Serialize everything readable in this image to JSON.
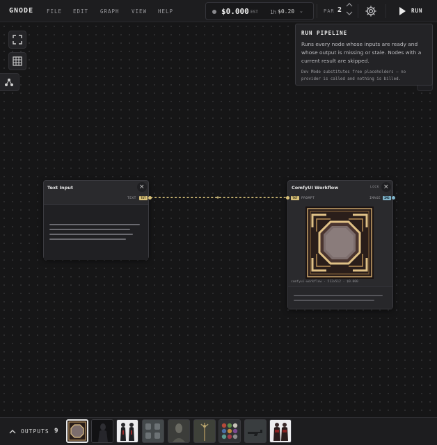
{
  "app": {
    "logo": "GNODE"
  },
  "menu": [
    "FILE",
    "EDIT",
    "GRAPH",
    "VIEW",
    "HELP"
  ],
  "cost": {
    "value": "$0.000",
    "est_label": "EST",
    "rate_label": "1h",
    "rate_value": "$0.20"
  },
  "parallel": {
    "label": "PAR",
    "value": "2"
  },
  "run": {
    "label": "RUN"
  },
  "tooltip": {
    "title": "RUN PIPELINE",
    "body": "Runs every node whose inputs are ready and whose output is missing or stale. Nodes with a current result are skipped.",
    "note": "Dev Mode substitutes free placeholders — no provider is called and nothing is billed."
  },
  "nodes": {
    "text_input": {
      "title": "Text Input",
      "close": "×",
      "out_port_label": "TEXT",
      "out_port_tag": "TXT"
    },
    "comfy": {
      "title": "ComfyUI Workflow",
      "lock": "LOCK",
      "close": "×",
      "in_port_tag": "TXT",
      "in_port_label": "PROMPT",
      "out_port_label": "IMAGE",
      "out_port_tag": "IMG",
      "footer": "comfyui-workflow · 512x512 · $0.000"
    }
  },
  "outputs": {
    "label": "OUTPUTS",
    "count": "9"
  },
  "colors": {
    "txt_tag_bg": "#d9c27a",
    "img_tag_bg": "#7fb3c9",
    "edge": "#d9c27a",
    "frame_gold": "#c9a46a"
  },
  "icons": {
    "fit": "fullscreen-icon",
    "grid": "grid-icon",
    "layout": "auto-layout-icon",
    "gear": "gear-icon",
    "run": "play-icon",
    "expand": "chevron-up-icon"
  }
}
